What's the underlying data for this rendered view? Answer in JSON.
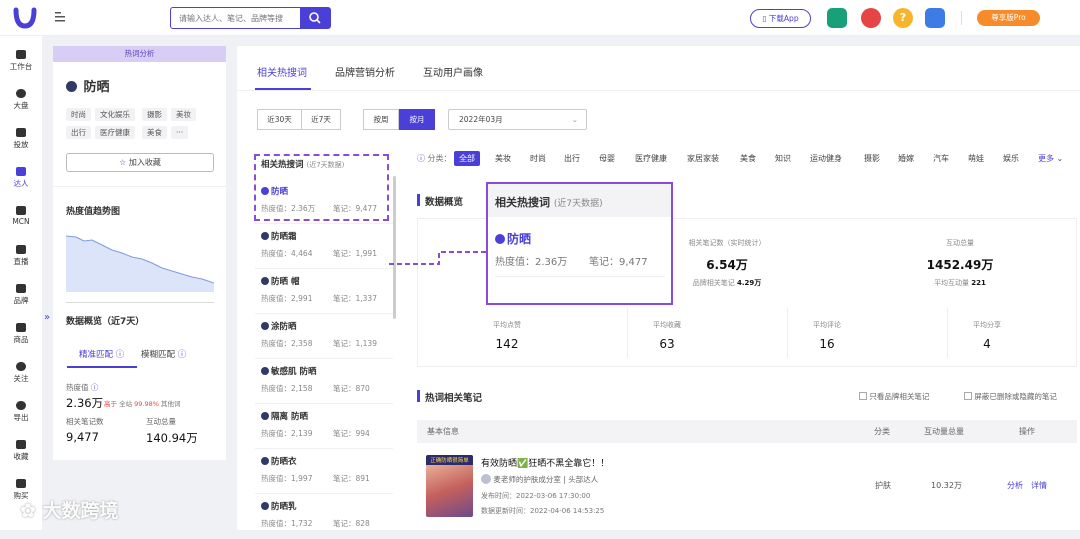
{
  "header": {
    "search_placeholder": "请输入达人、笔记、品牌等搜",
    "download_label": "下载App",
    "pro_label": "尊享版Pro"
  },
  "sidebar": {
    "items": [
      "工作台",
      "大盘",
      "投放",
      "达人",
      "MCN",
      "直播",
      "品牌",
      "商品",
      "关注",
      "导出",
      "收藏",
      "购买"
    ]
  },
  "left": {
    "header": "热词分析",
    "keyword": "防晒",
    "tags": [
      "时尚",
      "文化娱乐",
      "摄影",
      "美妆",
      "出行",
      "医疗健康",
      "美食",
      "···"
    ],
    "collect_label": "加入收藏",
    "trend_title": "热度值趋势图",
    "overview_title": "数据概览（近7天）",
    "tab_exact": "精准匹配",
    "tab_fuzzy": "模糊匹配",
    "heat_label": "热度值",
    "heat_value": "2.36万",
    "heat_compare_pre": "高于",
    "heat_compare_site": "全站",
    "heat_compare_pct": "99.98%",
    "heat_compare_post": "其他词",
    "notes_label": "相关笔记数",
    "notes_value": "9,477",
    "interact_label": "互动总量",
    "interact_value": "140.94万"
  },
  "main": {
    "tabs": [
      "相关热搜词",
      "品牌营销分析",
      "互动用户画像"
    ],
    "range_btns": [
      "近30天",
      "近7天"
    ],
    "period_btns": [
      "按周",
      "按月"
    ],
    "month": "2022年03月",
    "kw_header": "相关热搜词",
    "kw_header_sub": "(近7天数据)",
    "keywords": [
      {
        "name": "防晒",
        "heat": "热度值：2.36万",
        "notes": "笔记：9,477"
      },
      {
        "name": "防晒霜",
        "heat": "热度值：4,464",
        "notes": "笔记：1,991"
      },
      {
        "name": "防晒 帽",
        "heat": "热度值：2,991",
        "notes": "笔记：1,337"
      },
      {
        "name": "涂防晒",
        "heat": "热度值：2,358",
        "notes": "笔记：1,139"
      },
      {
        "name": "敏感肌 防晒",
        "heat": "热度值：2,158",
        "notes": "笔记：870"
      },
      {
        "name": "隔离 防晒",
        "heat": "热度值：2,139",
        "notes": "笔记：994"
      },
      {
        "name": "防晒衣",
        "heat": "热度值：1,997",
        "notes": "笔记：891"
      },
      {
        "name": "防晒乳",
        "heat": "热度值：1,732",
        "notes": "笔记：828"
      }
    ],
    "cat_label": "分类：",
    "categories": [
      "全部",
      "美妆",
      "时尚",
      "出行",
      "母婴",
      "医疗健康",
      "家居家装",
      "美食",
      "知识",
      "运动健身",
      "摄影",
      "婚嫁",
      "汽车",
      "萌娃",
      "娱乐"
    ],
    "more": "更多",
    "data_overview": "数据概览",
    "stats_top": [
      {
        "label": "相关笔记数（实时统计）",
        "value": "6.54万",
        "sub_pre": "品牌相关笔记",
        "sub_val": "4.29万"
      },
      {
        "label": "互动总量",
        "value": "1452.49万",
        "sub_pre": "平均互动量",
        "sub_val": "221"
      }
    ],
    "stats_bottom": [
      {
        "label": "平均点赞",
        "value": "142"
      },
      {
        "label": "平均收藏",
        "value": "63"
      },
      {
        "label": "平均评论",
        "value": "16"
      },
      {
        "label": "平均分享",
        "value": "4"
      }
    ],
    "notes_title": "热词相关笔记",
    "chk1": "只看品牌相关笔记",
    "chk2": "屏蔽已删除或隐藏的笔记",
    "table_headers": [
      "基本信息",
      "分类",
      "互动量总量",
      "操作"
    ],
    "row": {
      "title": "有效防晒✅狂晒不黑全靠它！！",
      "author": "麦老师的护肤成分室",
      "author_tag": "头部达人",
      "published": "发布时间：2022-03-06 17:30:00",
      "updated": "数据更新时间：2022-04-06 14:53:25",
      "category": "护肤",
      "interact": "10.32万",
      "act1": "分析",
      "act2": "详情",
      "thumb_text": "正确防晒很简单"
    }
  },
  "zoom": {
    "header": "相关热搜词",
    "sub": "(近7天数据)",
    "kw": "防晒",
    "heat": "热度值：2.36万",
    "notes": "笔记：9,477"
  },
  "watermark": "大数跨境",
  "colors": {
    "accent": "#4a40d8",
    "purple": "#8a4cd8",
    "orange": "#f78b2a"
  }
}
